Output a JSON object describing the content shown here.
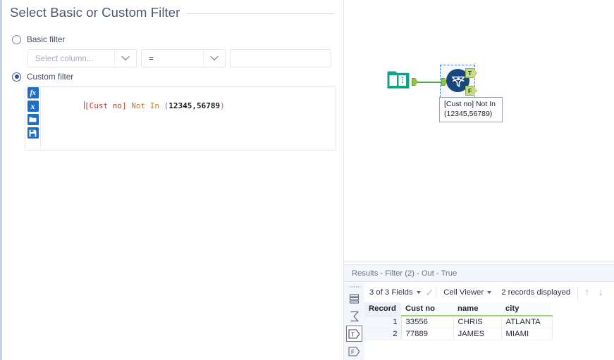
{
  "config_panel": {
    "title": "Select Basic or Custom Filter",
    "basic_filter": {
      "label": "Basic filter",
      "selected": false,
      "column_placeholder": "Select column...",
      "operator_value": "=",
      "value_text": ""
    },
    "custom_filter": {
      "label": "Custom filter",
      "selected": true,
      "expression": {
        "field": "[Cust no]",
        "keyword": "Not In",
        "open_paren": "(",
        "numbers": "12345,56789",
        "close_paren": ")",
        "full": "[Cust no] Not In (12345,56789)"
      },
      "toolbar": {
        "fx_label": "fx",
        "variable_label": "x",
        "open_icon": "folder-open-icon",
        "save_icon": "floppy-save-icon"
      }
    }
  },
  "canvas": {
    "input_tool": {
      "icon": "input-data-book-icon",
      "output_anchor": ""
    },
    "filter_tool": {
      "icon": "filter-funnel-icon",
      "selected": true,
      "true_anchor_label": "T",
      "false_anchor_label": "F",
      "annotation_line1": "[Cust no] Not In",
      "annotation_line2": "(12345,56789)"
    }
  },
  "results_panel": {
    "title": "Results - Filter (2) - Out - True",
    "toolbar": {
      "fields_label": "3 of 3 Fields",
      "viewer_label": "Cell Viewer",
      "records_label": "2 records displayed",
      "check_icon": "checkmark-icon",
      "up_icon": "arrow-up-icon",
      "down_icon": "arrow-down-icon"
    },
    "rail": {
      "grip": "drag-grip-icon",
      "records_icon": "records-list-icon",
      "sum_icon": "sigma-sum-icon",
      "true_anchor_label": "T",
      "false_anchor_label": "F",
      "selected_anchor": "T"
    },
    "grid": {
      "columns": [
        "Record",
        "Cust no",
        "name",
        "city"
      ],
      "rows": [
        {
          "record": "1",
          "cust_no": "33556",
          "name": "CHRIS",
          "city": "ATLANTA"
        },
        {
          "record": "2",
          "cust_no": "77889",
          "name": "JAMES",
          "city": "MIAMI"
        }
      ]
    }
  },
  "colors": {
    "accent_blue": "#2f7fd6",
    "tool_blue": "#17467f",
    "input_green": "#13a085",
    "anchor_green": "#8ec63f",
    "header_underline": "#9ad46a",
    "title_text": "#4a5875"
  }
}
